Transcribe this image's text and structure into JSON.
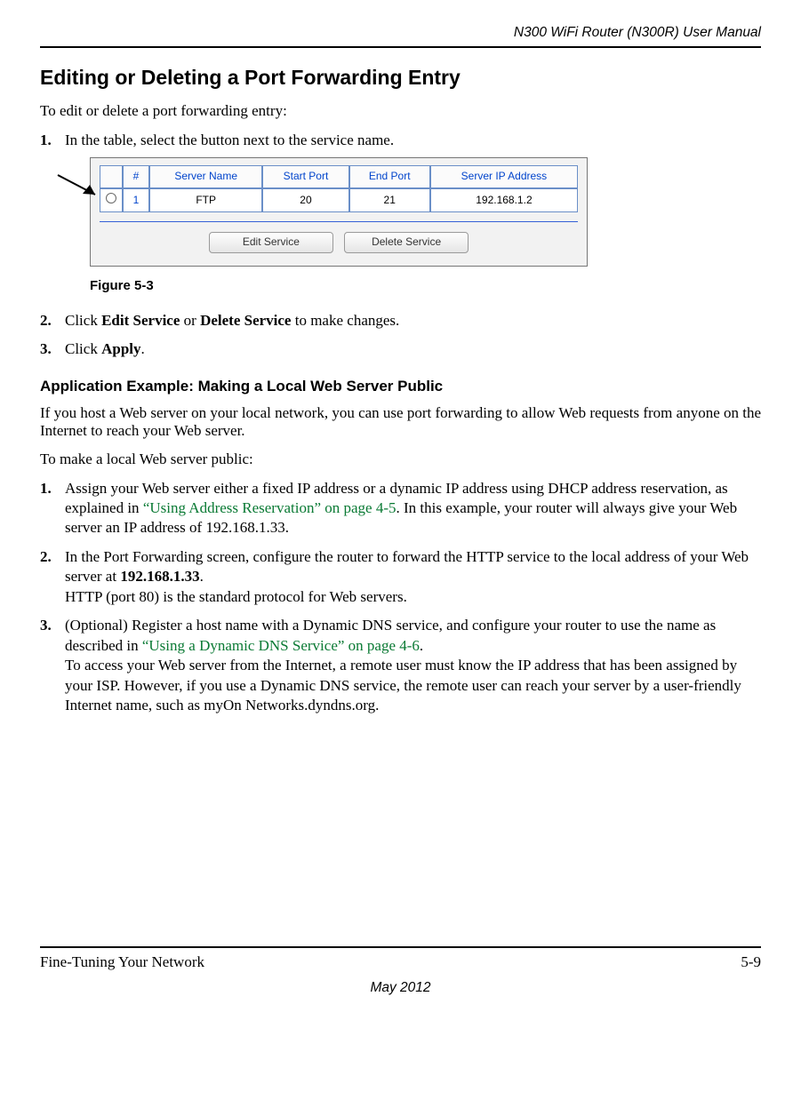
{
  "header": {
    "doc_title": "N300 WiFi Router (N300R) User Manual"
  },
  "section": {
    "heading": "Editing or Deleting a Port Forwarding Entry",
    "intro": "To edit or delete a port forwarding entry:"
  },
  "steps_a": {
    "s1": "In the table, select the button next to the service name.",
    "s2_pre": "Click ",
    "s2_b1": "Edit Service",
    "s2_mid": " or ",
    "s2_b2": "Delete Service",
    "s2_post": " to make changes.",
    "s3_pre": "Click ",
    "s3_b": "Apply",
    "s3_post": "."
  },
  "figure": {
    "caption": "Figure 5-3",
    "table": {
      "headers": {
        "num": "#",
        "name": "Server Name",
        "start": "Start Port",
        "end": "End Port",
        "ip": "Server IP Address"
      },
      "row": {
        "num": "1",
        "name": "FTP",
        "start": "20",
        "end": "21",
        "ip": "192.168.1.2"
      }
    },
    "buttons": {
      "edit": "Edit Service",
      "delete": "Delete Service"
    }
  },
  "subsection": {
    "heading": "Application Example: Making a Local Web Server Public",
    "p1": "If you host a Web server on your local network, you can use port forwarding to allow Web requests from anyone on the Internet to reach your Web server.",
    "p2": "To make a local Web server public:"
  },
  "steps_b": {
    "s1_a": "Assign your Web server either a fixed IP address or a dynamic IP address using DHCP address reservation, as explained in ",
    "s1_link": "“Using Address Reservation” on page 4-5",
    "s1_b": ". In this example, your router will always give your Web server an IP address of 192.168.1.33.",
    "s2_a": "In the Port Forwarding screen, configure the router to forward the HTTP service to the local address of your Web server at ",
    "s2_b_bold": "192.168.1.33",
    "s2_c": ".",
    "s2_d": "HTTP (port 80) is the standard protocol for Web servers.",
    "s3_a": "(Optional) Register a host name with a Dynamic DNS service, and configure your router to use the name as described in ",
    "s3_link": "“Using a Dynamic DNS Service” on page 4-6",
    "s3_b": ".",
    "s3_c": "To access your Web server from the Internet, a remote user must know the IP address that has been assigned by your ISP. However, if you use a Dynamic DNS service, the remote user can reach your server by a user-friendly Internet name, such as myOn Networks.dyndns.org."
  },
  "footer": {
    "left": "Fine-Tuning Your Network",
    "right": "5-9",
    "date": "May 2012"
  }
}
